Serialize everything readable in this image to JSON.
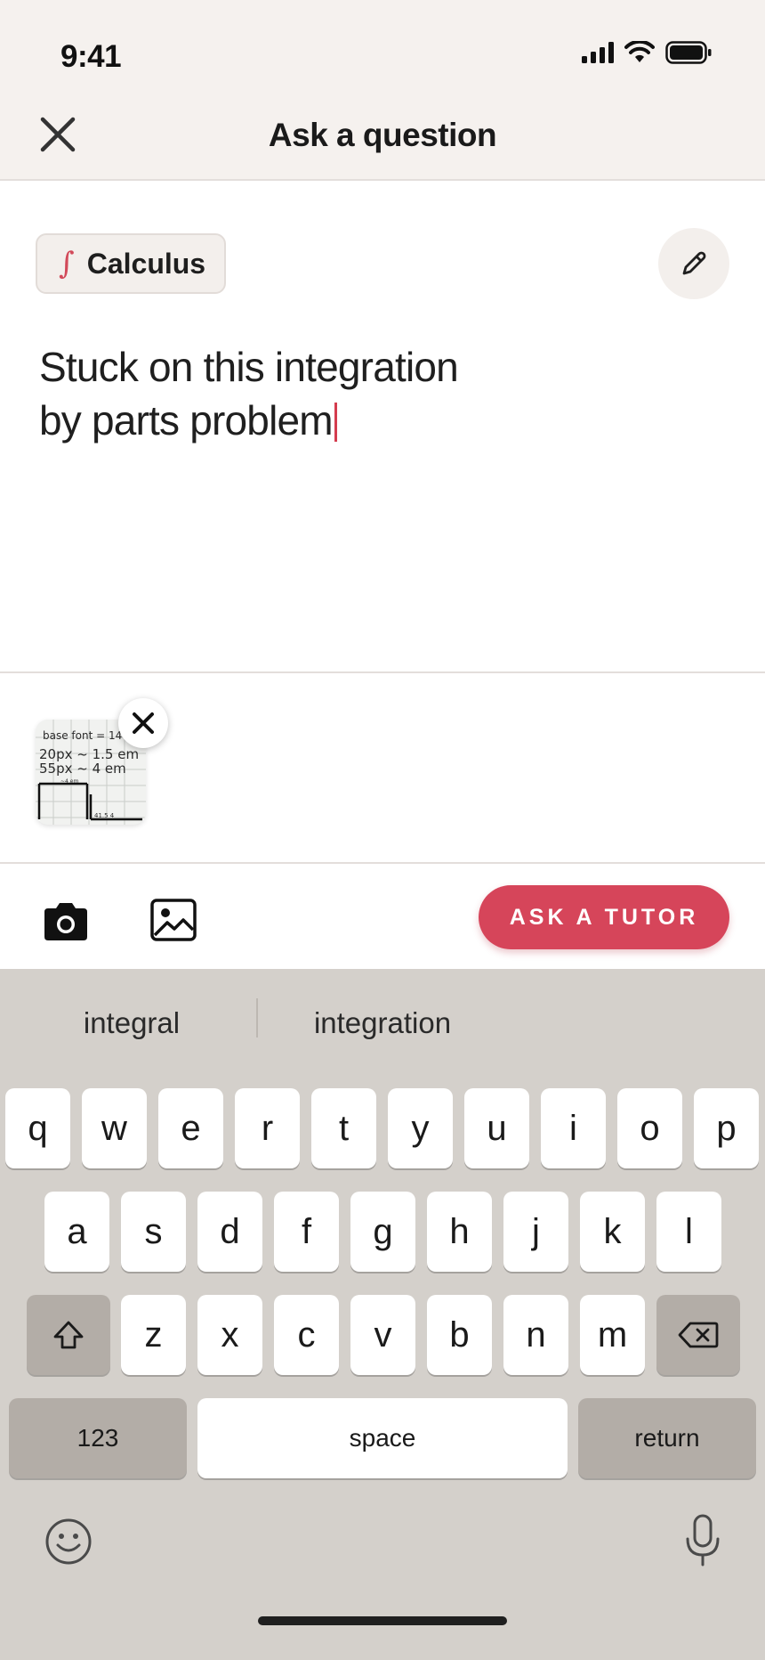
{
  "status_bar": {
    "time": "9:41",
    "icons": [
      "cellular-signal-icon",
      "wifi-icon",
      "battery-icon"
    ]
  },
  "header": {
    "title": "Ask a question",
    "close_icon": "close-icon"
  },
  "subject_chip": {
    "icon_glyph": "∫",
    "label": "Calculus"
  },
  "edit_icon": "pencil-icon",
  "question": {
    "text": "Stuck on this integration by parts problem",
    "line1": "Stuck on this integration",
    "line2": "by parts problem"
  },
  "attachment": {
    "thumbnail_text": [
      "base font = 14",
      "20px ~ 1.5 em",
      "55px ~ 4 em",
      "~4 em",
      "41.5 4"
    ],
    "remove_icon": "close-icon"
  },
  "toolbar": {
    "camera_icon": "camera-icon",
    "gallery_icon": "image-icon",
    "ask_label": "ASK A TUTOR"
  },
  "keyboard": {
    "suggestions": [
      "integral",
      "integration"
    ],
    "row1": [
      "q",
      "w",
      "e",
      "r",
      "t",
      "y",
      "u",
      "i",
      "o",
      "p"
    ],
    "row2": [
      "a",
      "s",
      "d",
      "f",
      "g",
      "h",
      "j",
      "k",
      "l"
    ],
    "row3": [
      "z",
      "x",
      "c",
      "v",
      "b",
      "n",
      "m"
    ],
    "numbers_label": "123",
    "space_label": "space",
    "return_label": "return"
  },
  "colors": {
    "accent": "#d6455a",
    "header_bg": "#f5f1ee",
    "keyboard_bg": "#d4d0cb"
  }
}
